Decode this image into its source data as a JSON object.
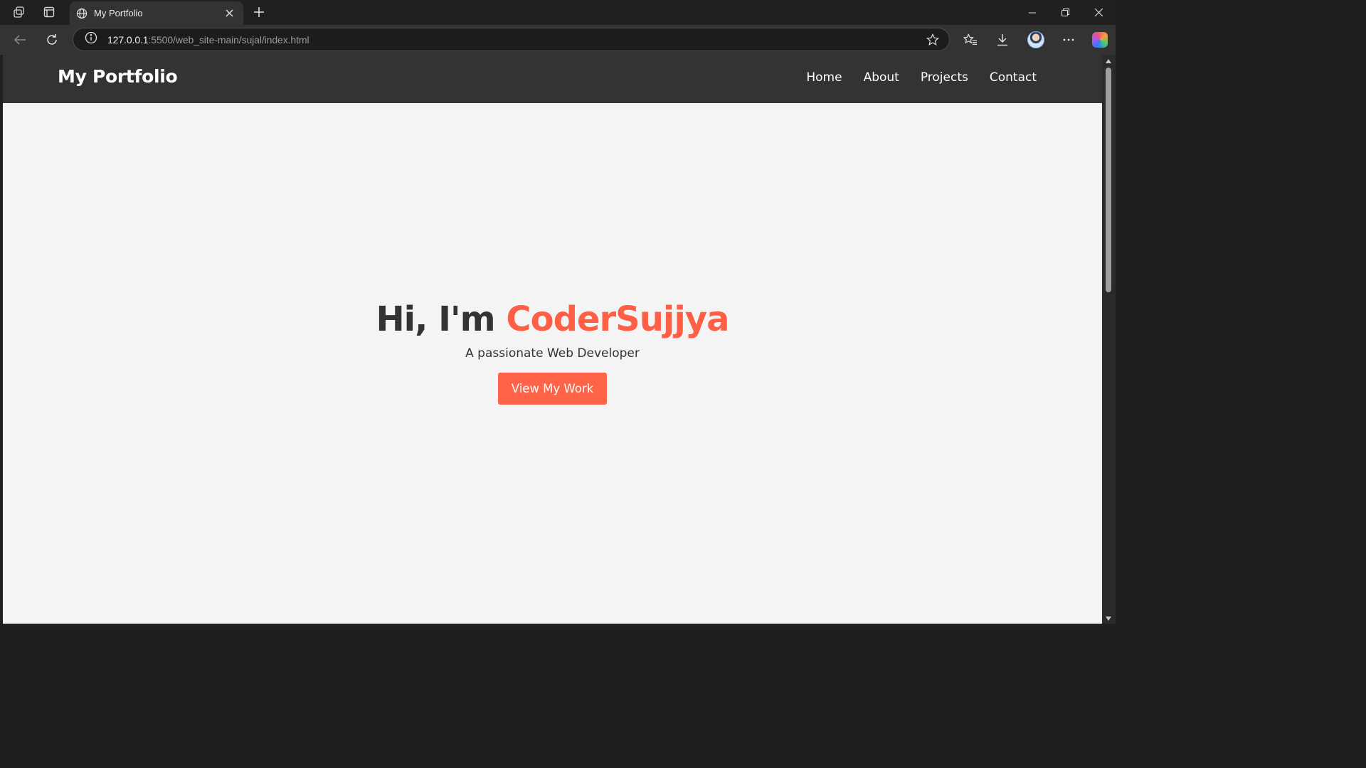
{
  "browser": {
    "tab": {
      "title": "My Portfolio",
      "icon": "globe-icon"
    },
    "address": {
      "host": "127.0.0.1",
      "path": ":5500/web_site-main/sujal/index.html"
    },
    "colors": {
      "chrome": "#202020",
      "toolbar": "#333333",
      "accent": "#ff6347"
    }
  },
  "site": {
    "nav": {
      "logo": "My Portfolio",
      "links": [
        "Home",
        "About",
        "Projects",
        "Contact"
      ]
    },
    "hero": {
      "greeting": "Hi, I'm ",
      "name": "CoderSujjya",
      "tagline": "A passionate Web Developer",
      "cta": "View My Work"
    }
  }
}
